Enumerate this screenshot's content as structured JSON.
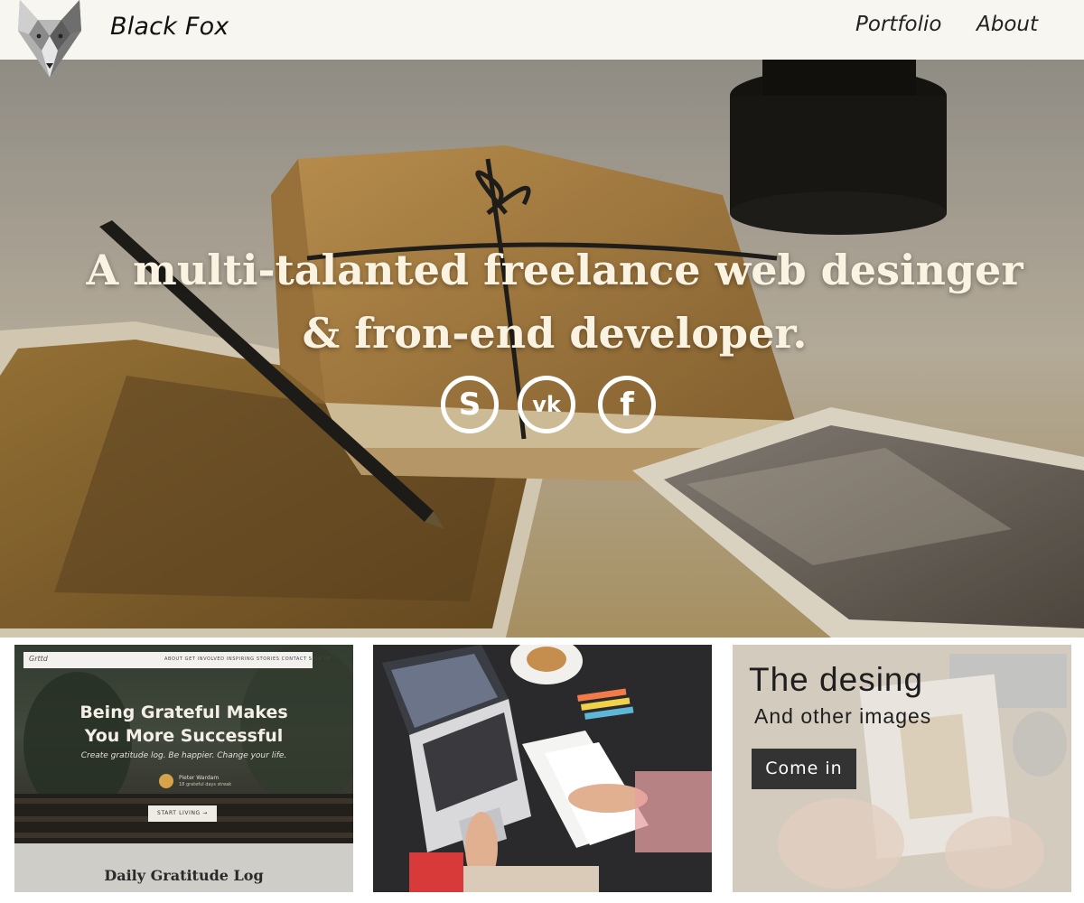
{
  "header": {
    "brand": "Black Fox",
    "nav": [
      {
        "label": "Portfolio"
      },
      {
        "label": "About"
      }
    ]
  },
  "hero": {
    "line1": "A multi-talanted freelance web desinger",
    "line2": "& fron-end developer.",
    "social": [
      {
        "icon": "skype-icon",
        "glyph": "S"
      },
      {
        "icon": "vk-icon",
        "glyph": "vk"
      },
      {
        "icon": "facebook-icon",
        "glyph": "f"
      }
    ]
  },
  "cards": [
    {
      "mini_brand": "Grttd",
      "mini_nav": "ABOUT   GET INVOLVED   INSPIRING STORIES   CONTACT   SIGN UP",
      "headline_1": "Being Grateful Makes",
      "headline_2": "You More Successful",
      "sub": "Create gratitude log. Be happier. Change your life.",
      "author": "Pieter Wardam",
      "author_note": "18 grateful days streak",
      "button": "START LIVING →",
      "caption": "Daily Gratitude Log"
    },
    {
      "image": "laptop-desk-photo"
    },
    {
      "title": "The desing",
      "subtitle": "And other images",
      "button": "Come in"
    }
  ],
  "colors": {
    "header_bg": "#f8f6f0",
    "hero_text": "#fbf3e2",
    "button_dark": "#333333"
  }
}
